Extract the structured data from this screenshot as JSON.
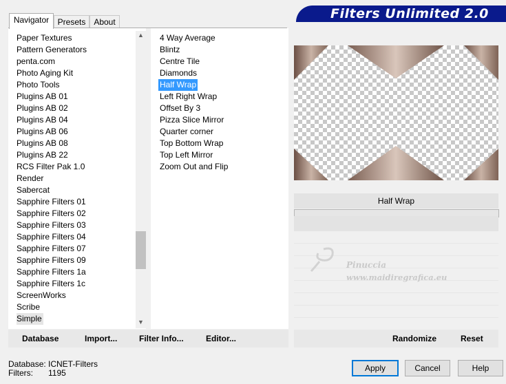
{
  "app": {
    "title": "Filters Unlimited 2.0"
  },
  "tabs": [
    {
      "label": "Navigator",
      "active": true
    },
    {
      "label": "Presets",
      "active": false
    },
    {
      "label": "About",
      "active": false
    }
  ],
  "categories": {
    "items": [
      "Paper Textures",
      "Pattern Generators",
      "penta.com",
      "Photo Aging Kit",
      "Photo Tools",
      "Plugins AB 01",
      "Plugins AB 02",
      "Plugins AB 04",
      "Plugins AB 06",
      "Plugins AB 08",
      "Plugins AB 22",
      "RCS Filter Pak 1.0",
      "Render",
      "Sabercat",
      "Sapphire Filters 01",
      "Sapphire Filters 02",
      "Sapphire Filters 03",
      "Sapphire Filters 04",
      "Sapphire Filters 07",
      "Sapphire Filters 09",
      "Sapphire Filters 1a",
      "Sapphire Filters 1c",
      "ScreenWorks",
      "Scribe",
      "Simple"
    ],
    "highlighted": "Simple"
  },
  "filters": {
    "items": [
      "4 Way Average",
      "Blintz",
      "Centre Tile",
      "Diamonds",
      "Half Wrap",
      "Left Right Wrap",
      "Offset By 3",
      "Pizza Slice Mirror",
      "Quarter corner",
      "Top Bottom Wrap",
      "Top Left Mirror",
      "Zoom Out and Flip"
    ],
    "selected": "Half Wrap"
  },
  "preview": {
    "filter_name": "Half Wrap"
  },
  "left_buttons": {
    "database": "Database",
    "import": "Import...",
    "filter_info": "Filter Info...",
    "editor": "Editor..."
  },
  "right_buttons": {
    "randomize": "Randomize",
    "reset": "Reset"
  },
  "status": {
    "database_label": "Database:",
    "database_value": "ICNET-Filters",
    "filters_label": "Filters:",
    "filters_value": "1195"
  },
  "dialog_buttons": {
    "apply": "Apply",
    "cancel": "Cancel",
    "help": "Help"
  },
  "watermark": {
    "line1": "Pinuccia",
    "line2": "www.maidiregrafica.eu"
  },
  "colors": {
    "banner": "#0a1a8c",
    "selection": "#3399ff",
    "accent": "#0078d7"
  }
}
